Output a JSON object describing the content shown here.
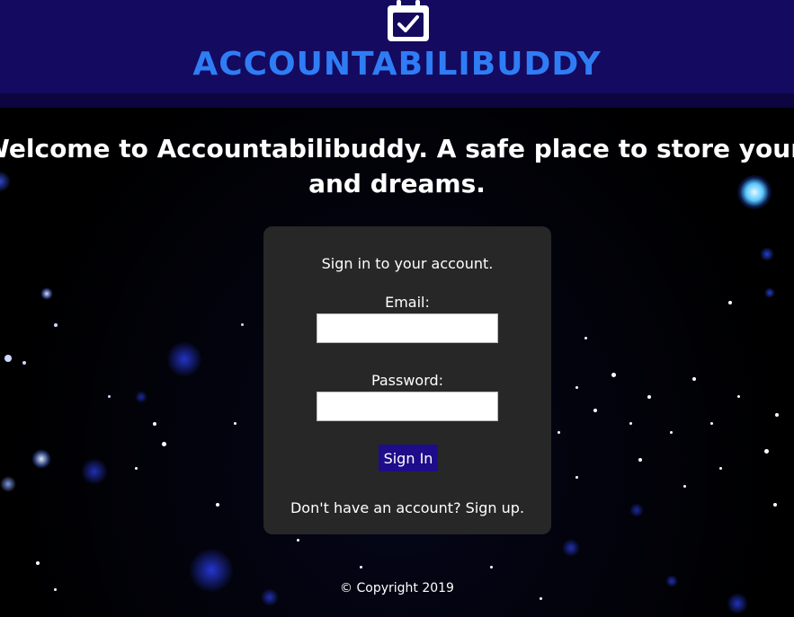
{
  "header": {
    "brand": "ACCOUNTABILIBUDDY",
    "logo_icon": "calendar-check-icon"
  },
  "welcome": {
    "line1": "Welcome to Accountabilibuddy. A safe place to store your hopes",
    "line2": "and dreams."
  },
  "login": {
    "subtitle": "Sign in to your account.",
    "email_label": "Email:",
    "email_value": "",
    "password_label": "Password:",
    "password_value": "",
    "signin_label": "Sign In",
    "signup_text": "Don't have an account? Sign up."
  },
  "footer": {
    "copyright": "© Copyright 2019"
  },
  "colors": {
    "header_bg": "#140a5f",
    "brand": "#2f7df5",
    "card_bg": "#272727",
    "button_bg": "#1d0d8a"
  }
}
